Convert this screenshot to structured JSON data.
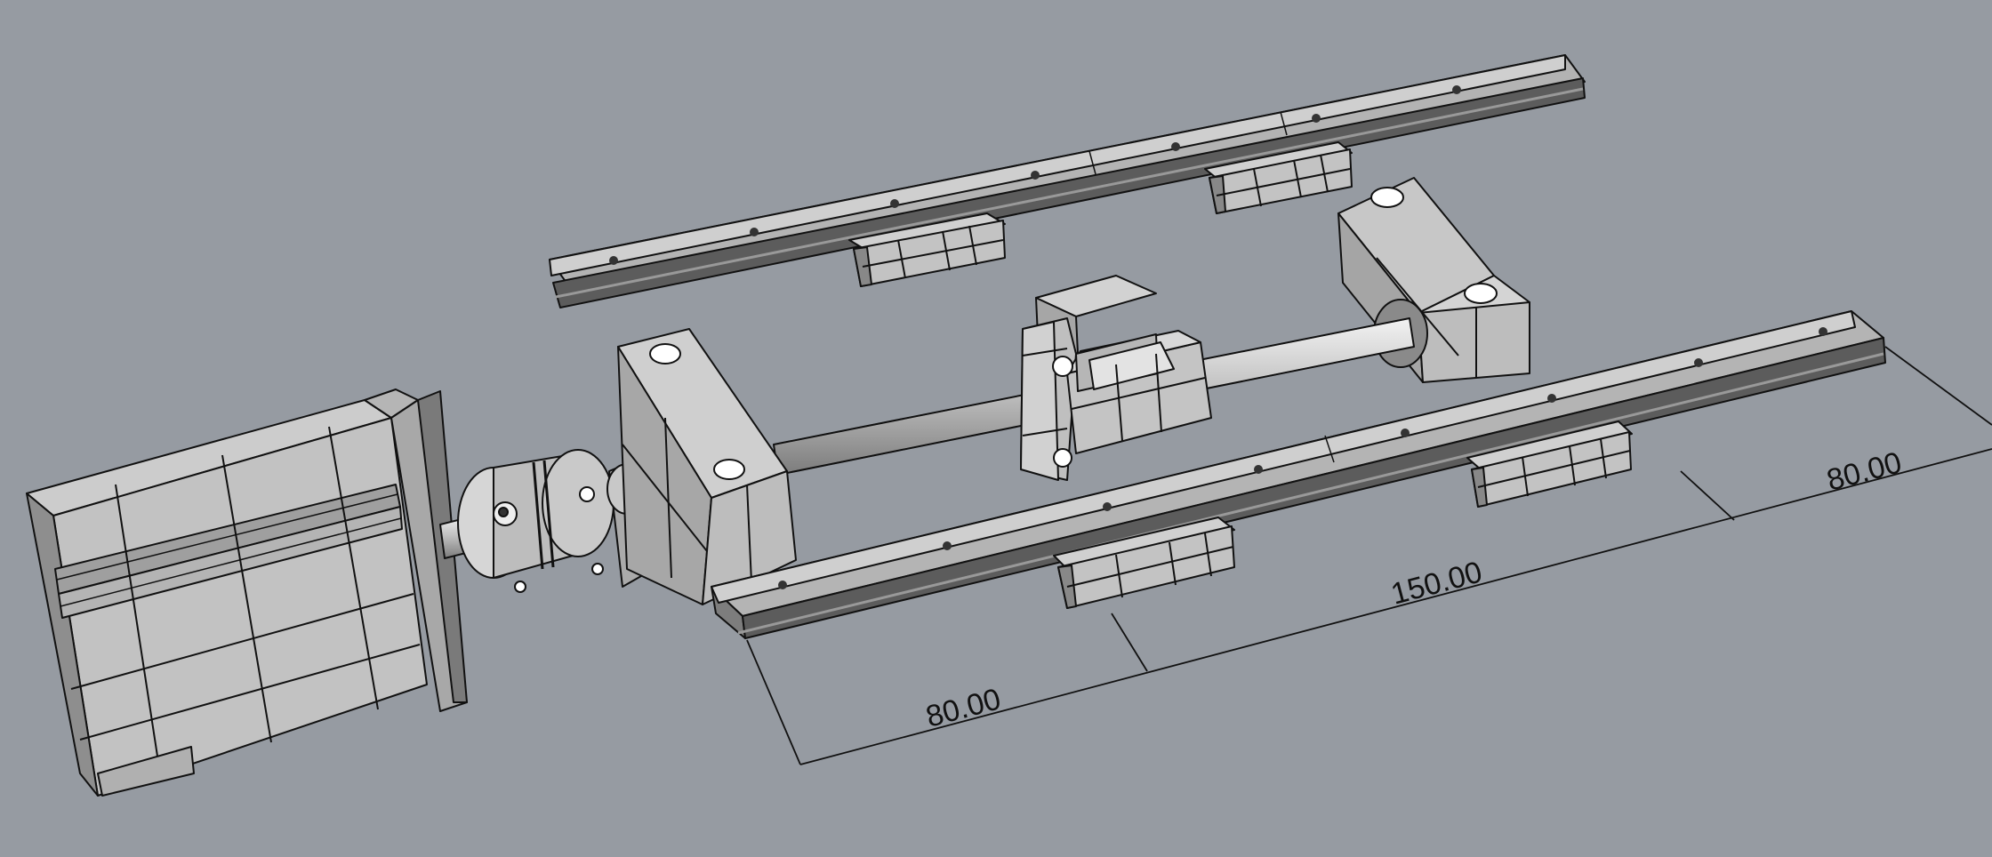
{
  "colors": {
    "background": "#969ba2",
    "part_light": "#c9c9c9",
    "part_mid": "#a9a9a9",
    "part_dark": "#6e6e6e",
    "edge": "#111111",
    "dimension_line": "#111111"
  },
  "dimensions": {
    "d1": "80.00",
    "d2": "150.00",
    "d3": "80.00"
  },
  "parts": [
    "stepper-motor",
    "coupling",
    "fixed-bearing-block",
    "ball-screw",
    "ball-nut",
    "support-bearing-block",
    "linear-rail-back",
    "linear-rail-front",
    "carriage-blocks"
  ]
}
